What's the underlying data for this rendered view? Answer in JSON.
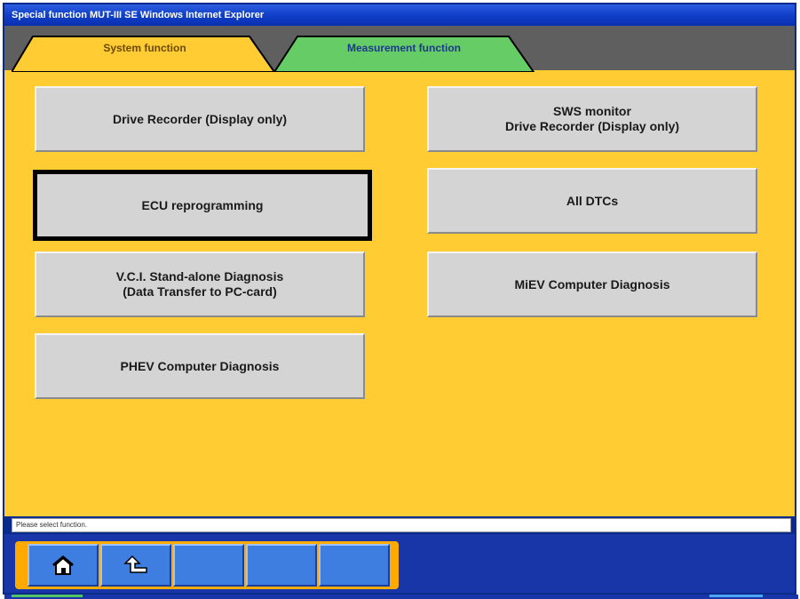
{
  "window": {
    "title": "Special function MUT-III SE  Windows Internet Explorer"
  },
  "tabs": [
    {
      "label": "System function",
      "state": "active",
      "color": "#ffcc33"
    },
    {
      "label": "Measurement function",
      "state": "inactive",
      "color": "#66cc66"
    }
  ],
  "functions": {
    "left": [
      {
        "label": "Drive Recorder (Display only)"
      },
      {
        "label": "ECU reprogramming",
        "selected": true
      },
      {
        "label": "V.C.I. Stand-alone Diagnosis\n(Data Transfer to PC-card)"
      },
      {
        "label": "PHEV Computer Diagnosis"
      }
    ],
    "right": [
      {
        "label": "SWS monitor\nDrive Recorder (Display only)"
      },
      {
        "label": "All DTCs"
      },
      {
        "label": "MiEV Computer Diagnosis"
      }
    ]
  },
  "status": {
    "message": "Please select function."
  },
  "toolbar": {
    "buttons": [
      {
        "icon": "home-icon"
      },
      {
        "icon": "back-arrow-icon"
      },
      {
        "icon": ""
      },
      {
        "icon": ""
      },
      {
        "icon": ""
      }
    ]
  },
  "colors": {
    "panel_background": "#ffcc33",
    "title_bar": "#1040c8",
    "bottom_bar": "#1836a8",
    "toolbar_frame": "#ffaa00",
    "button_face": "#d4d4d4"
  }
}
